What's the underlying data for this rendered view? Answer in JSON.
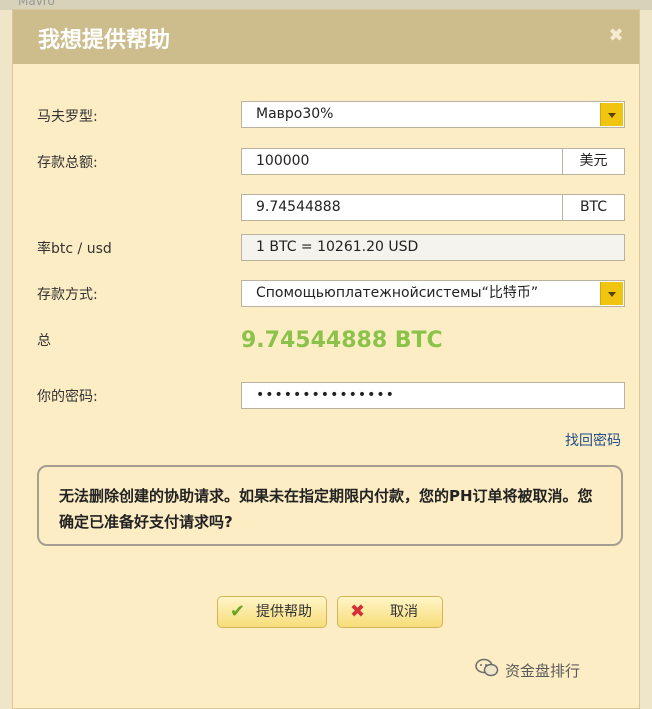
{
  "background": {
    "window_hint": "Mavro"
  },
  "dialog": {
    "title": "我想提供帮助",
    "close_icon": "close-icon"
  },
  "form": {
    "mavro_type": {
      "label": "马夫罗型:",
      "value": "Мавро30%"
    },
    "deposit_amount": {
      "label": "存款总额:",
      "value": "100000",
      "unit": "美元"
    },
    "btc_amount": {
      "value": "9.74544888",
      "unit": "BTC"
    },
    "rate": {
      "label": "率btc / usd",
      "value": "1 BTC = 10261.20 USD"
    },
    "deposit_method": {
      "label": "存款方式:",
      "value": "Спомощьюплатежнойсистемы“比特币”"
    },
    "total": {
      "label": "总",
      "value": "9.74544888 BTC"
    },
    "password": {
      "label": "你的密码:",
      "value": "•••••••••••••••"
    },
    "recover_link": "找回密码"
  },
  "warning": {
    "text": "无法删除创建的协助请求。如果未在指定期限内付款，您的PH订单将被取消。您确定已准备好支付请求吗?"
  },
  "buttons": {
    "submit": {
      "label": "提供帮助",
      "icon": "check-icon"
    },
    "cancel": {
      "label": "取消",
      "icon": "x-icon"
    }
  },
  "watermark": {
    "text": "资金盘排行"
  },
  "colors": {
    "total_green": "#8bc34a",
    "accent_yellow": "#f1c40f",
    "dialog_bg": "#fdedc5",
    "title_bg": "#cdbd8d"
  }
}
